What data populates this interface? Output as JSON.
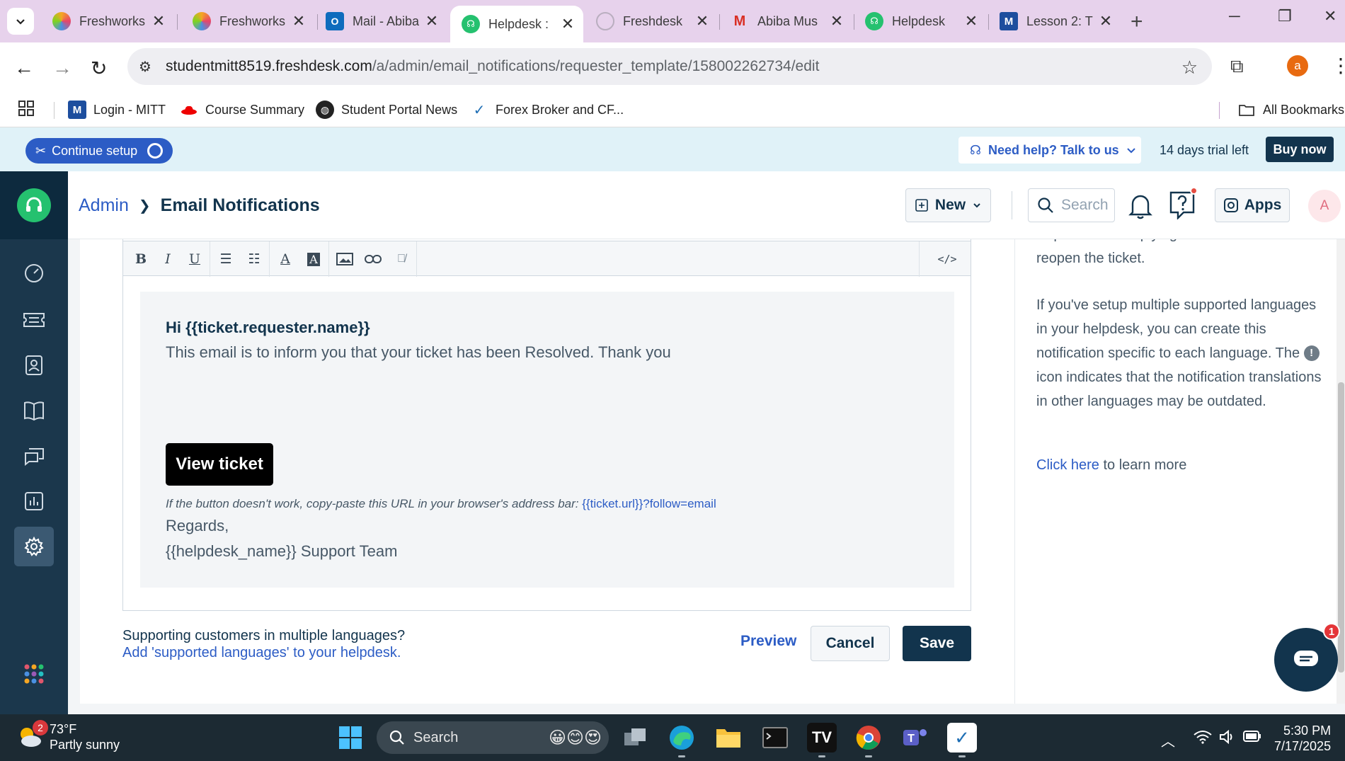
{
  "browser": {
    "tabs": [
      {
        "label": "Freshworks",
        "icon": "freshworks-icon"
      },
      {
        "label": "Freshworks",
        "icon": "freshworks-icon"
      },
      {
        "label": "Mail - Abiba",
        "icon": "outlook-icon"
      },
      {
        "label": "Helpdesk :",
        "icon": "freshdesk-icon",
        "active": true
      },
      {
        "label": "Freshdesk",
        "icon": "openai-icon"
      },
      {
        "label": "Abiba Mus",
        "icon": "gmail-icon"
      },
      {
        "label": "Helpdesk",
        "icon": "freshdesk-icon"
      },
      {
        "label": "Lesson 2: T",
        "icon": "mitt-icon"
      }
    ],
    "url_host": "studentmitt8519.freshdesk.com",
    "url_path": "/a/admin/email_notifications/requester_template/158002262734/edit",
    "profile_initial": "a",
    "bookmarks": [
      {
        "label": "Login - MITT",
        "icon": "mitt-icon"
      },
      {
        "label": "Course Summary",
        "icon": "redhat-icon"
      },
      {
        "label": "Student Portal News",
        "icon": "globe-icon"
      },
      {
        "label": "Forex Broker and CF...",
        "icon": "swoosh-icon"
      }
    ],
    "all_bookmarks": "All Bookmarks"
  },
  "setup": {
    "continue_label": "Continue setup",
    "need_help": "Need help? Talk to us",
    "trial": "14 days trial left",
    "buy_now": "Buy now"
  },
  "header": {
    "crumb_admin": "Admin",
    "crumb_current": "Email Notifications",
    "new_label": "New",
    "search_placeholder": "Search",
    "apps_label": "Apps",
    "avatar_initial": "A"
  },
  "editor": {
    "greeting": "Hi {{ticket.requester.name}}",
    "message": "This email is to inform you that your ticket has been Resolved. Thank you",
    "button": "View ticket",
    "hint_prefix": "If the button doesn't work, copy-paste this URL in your browser's address bar: ",
    "hint_link": "{{ticket.url}}?follow=email",
    "regards": "Regards,",
    "team": "{{helpdesk_name}} Support Team"
  },
  "footer": {
    "lang_question": "Supporting customers in multiple languages?",
    "lang_link": "Add 'supported languages' to your helpdesk.",
    "preview": "Preview",
    "cancel": "Cancel",
    "save": "Save"
  },
  "help_panel": {
    "partial_top": "requester that replying to this mail will",
    "reopen": "reopen the ticket.",
    "multi_lang_1": "If you've setup multiple supported languages in your helpdesk, you can create this notification specific to each language. The",
    "multi_lang_2": "icon indicates that the notification translations in other languages may be outdated.",
    "click_here": "Click here",
    "learn_more": " to learn more"
  },
  "chat": {
    "badge": "1"
  },
  "taskbar": {
    "temp": "73°F",
    "condition": "Partly sunny",
    "weather_badge": "2",
    "search": "Search",
    "time": "5:30 PM",
    "date": "7/17/2025"
  }
}
